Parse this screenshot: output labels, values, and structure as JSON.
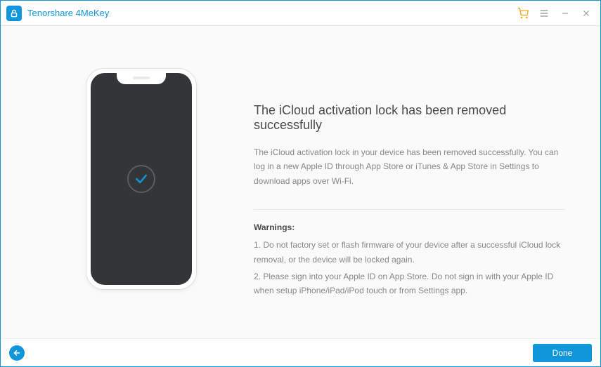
{
  "app": {
    "title": "Tenorshare 4MeKey"
  },
  "main": {
    "heading": "The iCloud activation lock has been removed successfully",
    "description": "The iCloud activation lock in your device has been removed successfully. You can log in a new Apple ID through App Store or iTunes & App Store in Settings to download apps over Wi-Fi.",
    "warnings_title": "Warnings:",
    "warning1": "1. Do not factory set or flash firmware of your device after a successful iCloud lock removal, or the device will be locked again.",
    "warning2": "2. Please sign into your Apple ID on App Store. Do not sign in with your Apple ID when setup iPhone/iPad/iPod touch or from Settings app."
  },
  "footer": {
    "done_label": "Done"
  }
}
